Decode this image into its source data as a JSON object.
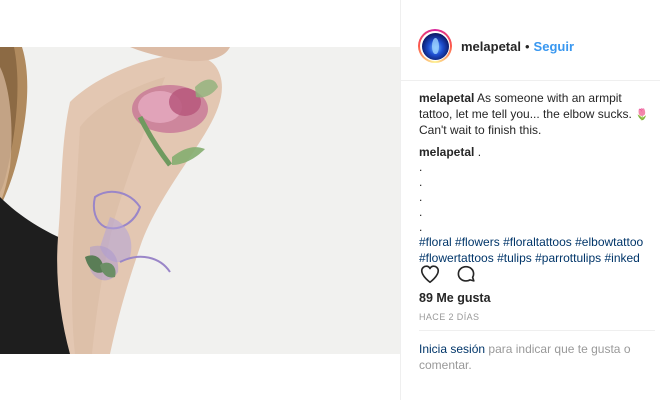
{
  "post": {
    "username": "melapetal",
    "dot": "•",
    "follow_label": "Seguir",
    "avatar_icon": "avatar-icon",
    "caption": {
      "author": "melapetal",
      "text": "As someone with an armpit tattoo, let me tell you... the elbow sucks.",
      "emoji": "🌷",
      "text_after": "Can't wait to finish this."
    },
    "comment": {
      "author": "melapetal",
      "text": ".",
      "dots": [
        ".",
        ".",
        ".",
        ".",
        "."
      ],
      "hashtags": [
        "#floral",
        "#flowers",
        "#floraltattoos",
        "#elbowtattoo",
        "#flowertattoos",
        "#tulips",
        "#parrottulips",
        "#inked"
      ]
    },
    "actions": {
      "like_icon": "heart-icon",
      "comment_icon": "comment-icon"
    },
    "likes_text": "89 Me gusta",
    "time_text": "HACE 2 DÍAS",
    "login_link": "Inicia sesión",
    "login_text": "para indicar que te gusta o comentar."
  },
  "colors": {
    "link_blue": "#3897f0",
    "hashtag_blue": "#003569",
    "muted": "#999999",
    "text": "#262626"
  }
}
